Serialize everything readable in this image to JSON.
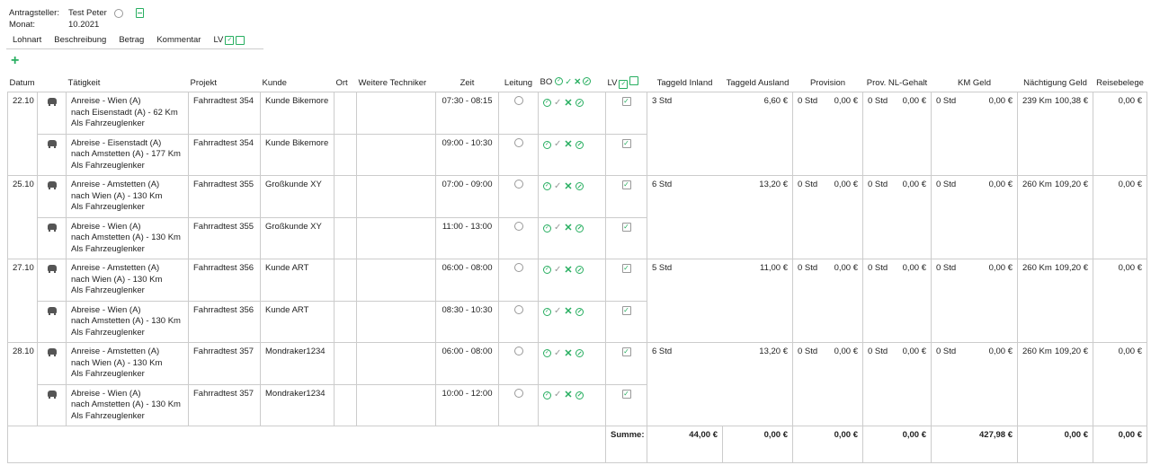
{
  "header": {
    "applicant_label": "Antragsteller:",
    "applicant_value": "Test Peter",
    "month_label": "Monat:",
    "month_value": "10.2021"
  },
  "menu": [
    "Lohnart",
    "Beschreibung",
    "Betrag",
    "Kommentar",
    "LV"
  ],
  "columns": {
    "datum": "Datum",
    "taetigkeit": "Tätigkeit",
    "projekt": "Projekt",
    "kunde": "Kunde",
    "ort": "Ort",
    "techniker": "Weitere Techniker",
    "zeit": "Zeit",
    "leitung": "Leitung",
    "bo": "BO",
    "lv": "LV",
    "taggeld_inland": "Taggeld Inland",
    "taggeld_ausland": "Taggeld Ausland",
    "provision": "Provision",
    "prov_nl": "Prov. NL-Gehalt",
    "km_geld": "KM Geld",
    "naechtigung": "Nächtigung Geld",
    "reisebelege": "Reisebelege"
  },
  "days": [
    {
      "date": "22.10",
      "trips": [
        {
          "line1": "Anreise - Wien (A)",
          "line2": "nach Eisenstadt (A) - 62 Km",
          "line3": "Als Fahrzeuglenker",
          "project": "Fahrradtest 354",
          "customer": "Kunde Bikemore",
          "time": "07:30 - 08:15"
        },
        {
          "line1": "Abreise - Eisenstadt (A)",
          "line2": "nach Amstetten (A) - 177 Km",
          "line3": "Als Fahrzeuglenker",
          "project": "Fahrradtest 354",
          "customer": "Kunde Bikemore",
          "time": "09:00 - 10:30"
        }
      ],
      "ti_h": "3 Std",
      "ti_eur": "6,60 €",
      "ta_h": "0 Std",
      "ta_eur": "0,00 €",
      "pr_h": "0 Std",
      "pr_eur": "0,00 €",
      "pn_h": "0 Std",
      "pn_eur": "0,00 €",
      "km": "239 Km",
      "km_eur": "100,38 €",
      "na_eur": "0,00 €",
      "rb_eur": "0,00 €"
    },
    {
      "date": "25.10",
      "trips": [
        {
          "line1": "Anreise - Amstetten (A)",
          "line2": "nach Wien (A) - 130 Km",
          "line3": "Als Fahrzeuglenker",
          "project": "Fahrradtest 355",
          "customer": "Großkunde XY",
          "time": "07:00 - 09:00"
        },
        {
          "line1": "Abreise - Wien (A)",
          "line2": "nach Amstetten (A) - 130 Km",
          "line3": "Als Fahrzeuglenker",
          "project": "Fahrradtest 355",
          "customer": "Großkunde XY",
          "time": "11:00 - 13:00"
        }
      ],
      "ti_h": "6 Std",
      "ti_eur": "13,20 €",
      "ta_h": "0 Std",
      "ta_eur": "0,00 €",
      "pr_h": "0 Std",
      "pr_eur": "0,00 €",
      "pn_h": "0 Std",
      "pn_eur": "0,00 €",
      "km": "260 Km",
      "km_eur": "109,20 €",
      "na_eur": "0,00 €",
      "rb_eur": "0,00 €"
    },
    {
      "date": "27.10",
      "trips": [
        {
          "line1": "Anreise - Amstetten (A)",
          "line2": "nach Wien (A) - 130 Km",
          "line3": "Als Fahrzeuglenker",
          "project": "Fahrradtest 356",
          "customer": "Kunde ART",
          "time": "06:00 - 08:00"
        },
        {
          "line1": "Abreise - Wien (A)",
          "line2": "nach Amstetten (A) - 130 Km",
          "line3": "Als Fahrzeuglenker",
          "project": "Fahrradtest 356",
          "customer": "Kunde ART",
          "time": "08:30 - 10:30"
        }
      ],
      "ti_h": "5 Std",
      "ti_eur": "11,00 €",
      "ta_h": "0 Std",
      "ta_eur": "0,00 €",
      "pr_h": "0 Std",
      "pr_eur": "0,00 €",
      "pn_h": "0 Std",
      "pn_eur": "0,00 €",
      "km": "260 Km",
      "km_eur": "109,20 €",
      "na_eur": "0,00 €",
      "rb_eur": "0,00 €"
    },
    {
      "date": "28.10",
      "trips": [
        {
          "line1": "Anreise - Amstetten (A)",
          "line2": "nach Wien (A) - 130 Km",
          "line3": "Als Fahrzeuglenker",
          "project": "Fahrradtest 357",
          "customer": "Mondraker1234",
          "time": "06:00 - 08:00"
        },
        {
          "line1": "Abreise - Wien (A)",
          "line2": "nach Amstetten (A) - 130 Km",
          "line3": "Als Fahrzeuglenker",
          "project": "Fahrradtest 357",
          "customer": "Mondraker1234",
          "time": "10:00 - 12:00"
        }
      ],
      "ti_h": "6 Std",
      "ti_eur": "13,20 €",
      "ta_h": "0 Std",
      "ta_eur": "0,00 €",
      "pr_h": "0 Std",
      "pr_eur": "0,00 €",
      "pn_h": "0 Std",
      "pn_eur": "0,00 €",
      "km": "260 Km",
      "km_eur": "109,20 €",
      "na_eur": "0,00 €",
      "rb_eur": "0,00 €"
    }
  ],
  "sum": {
    "label": "Summe:",
    "taggeld_inland": "44,00 €",
    "taggeld_ausland": "0,00 €",
    "provision": "0,00 €",
    "prov_nl": "0,00 €",
    "km_geld": "427,98 €",
    "naechtigung": "0,00 €",
    "reisebelege": "0,00 €"
  },
  "accent_color": "#27ae60"
}
